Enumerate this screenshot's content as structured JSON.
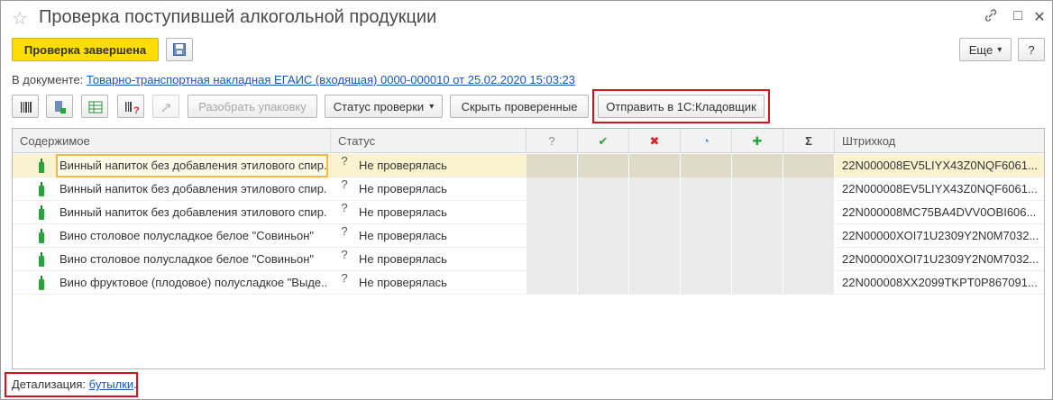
{
  "window": {
    "title": "Проверка поступившей алкогольной продукции",
    "star_glyph": "☆",
    "link_glyph": "🔗",
    "maximize_glyph": "□",
    "close_glyph": "✕"
  },
  "toolbar": {
    "done_label": "Проверка завершена",
    "more_label": "Еще",
    "more_arrow": "▾",
    "help_label": "?"
  },
  "document": {
    "prefix": "В документе:",
    "link": "Товарно-транспортная накладная ЕГАИС (входящая) 0000-000010 от 25.02.2020 15:03:23"
  },
  "actions": {
    "unpack_label": "Разобрать упаковку",
    "status_label": "Статус проверки",
    "status_arrow": "▾",
    "hide_checked_label": "Скрыть проверенные",
    "send_label": "Отправить в 1С:Кладовщик"
  },
  "table": {
    "columns": {
      "content": "Содержимое",
      "status": "Статус",
      "q": "?",
      "ok": "✔",
      "err": "✖",
      "partial": "◔",
      "plus": "✚",
      "sum": "Σ",
      "barcode": "Штрихкод"
    },
    "rows": [
      {
        "content": "Винный напиток без добавления этилового спир...",
        "status_glyph": "?",
        "status": "Не проверялась",
        "barcode": "22N000008EV5LIYX43Z0NQF6061..."
      },
      {
        "content": "Винный напиток без добавления этилового спир...",
        "status_glyph": "?",
        "status": "Не проверялась",
        "barcode": "22N000008EV5LIYX43Z0NQF6061..."
      },
      {
        "content": "Винный напиток без добавления этилового спир...",
        "status_glyph": "?",
        "status": "Не проверялась",
        "barcode": "22N000008MC75BA4DVV0OBI606..."
      },
      {
        "content": "Вино столовое полусладкое белое \"Совиньон\"",
        "status_glyph": "?",
        "status": "Не проверялась",
        "barcode": "22N00000XOI71U2309Y2N0M7032..."
      },
      {
        "content": "Вино столовое полусладкое белое \"Совиньон\"",
        "status_glyph": "?",
        "status": "Не проверялась",
        "barcode": "22N00000XOI71U2309Y2N0M7032..."
      },
      {
        "content": "Вино фруктовое (плодовое) полусладкое \"Выде...",
        "status_glyph": "?",
        "status": "Не проверялась",
        "barcode": "22N000008XX2099TKPT0P867091..."
      }
    ]
  },
  "footer": {
    "prefix": "Детализация:",
    "link": "бутылки",
    "suffix": "."
  },
  "colors": {
    "accent": "#ffdd00",
    "link": "#1a56b6",
    "highlight": "#d0141d",
    "ok": "#2aa43a",
    "err": "#d9262d",
    "plus": "#2aa43a"
  }
}
